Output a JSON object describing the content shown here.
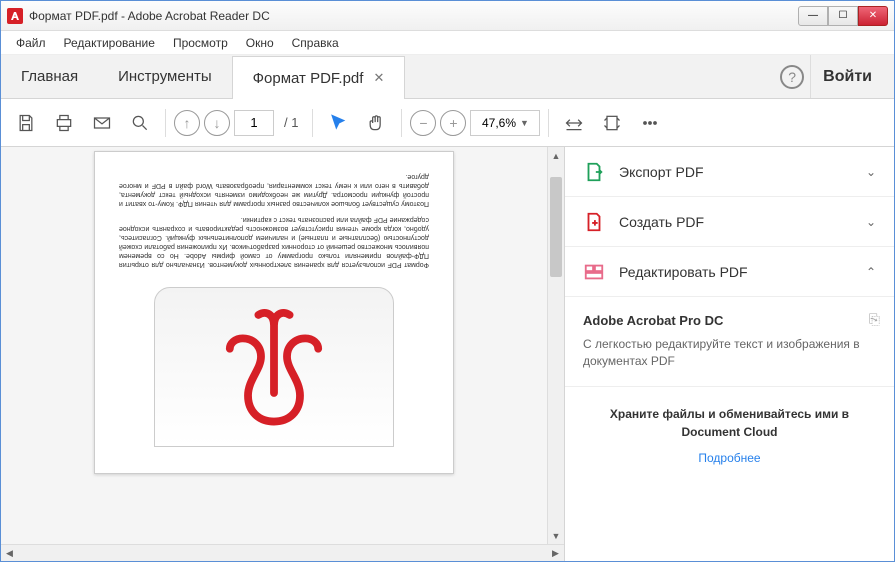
{
  "window": {
    "title": "Формат PDF.pdf - Adobe Acrobat Reader DC"
  },
  "menu": {
    "file": "Файл",
    "edit": "Редактирование",
    "view": "Просмотр",
    "window": "Окно",
    "help": "Справка"
  },
  "tabs": {
    "home": "Главная",
    "tools": "Инструменты",
    "doc": "Формат PDF.pdf",
    "signin": "Войти"
  },
  "toolbar": {
    "page_current": "1",
    "page_total": "/ 1",
    "zoom": "47,6%"
  },
  "sidepanel": {
    "export": "Экспорт PDF",
    "create": "Создать PDF",
    "edit": "Редактировать PDF",
    "pro_title": "Adobe Acrobat Pro DC",
    "pro_desc": "С легкостью редактируйте текст и изображения в документах PDF",
    "cloud_msg": "Храните файлы и обменивайтесь ими в Document Cloud",
    "cloud_link": "Подробнее"
  },
  "document": {
    "p1": "Формат PDF используется для хранения электронных документов. Изначально для открытия ПДФ-файлов применяли только программу от самой фирмы Adobe. Но со временем появилось множество решений от сторонних разработчиков. Их приложения работали схожей доступностью (бесплатные и платные) и наличием дополнительных функций. Согласитесь, удобно, когда кроме чтения присутствует возможность редактировать и сохранять исходное содержание PDF файла или распознать текст с картинки.",
    "p2": "Поэтому существует большое количество разных программ для чтения ПДФ. Кому-то хватит и простой функции просмотра. Другим же необходимо изменять исходный текст документа, добавить в него или к нему текст комментария, преобразовать Word файл в PDF и многое другое."
  },
  "colors": {
    "accent_red": "#d62027",
    "accent_blue": "#2680eb",
    "panel_green": "#1fa05a",
    "panel_pink": "#e86b8a"
  }
}
